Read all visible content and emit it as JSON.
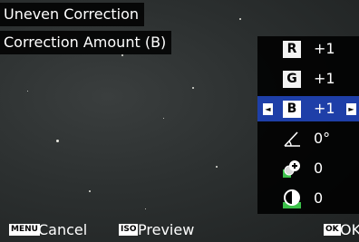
{
  "header": {
    "title": "Uneven Correction",
    "subtitle": "Correction Amount (B)"
  },
  "panel": {
    "items": [
      {
        "label": "R",
        "value": "+1"
      },
      {
        "label": "G",
        "value": "+1"
      },
      {
        "label": "B",
        "value": "+1"
      },
      {
        "icon": "slope-angle-icon",
        "value": "0°"
      },
      {
        "icon": "saturation-plus-icon",
        "value": "0"
      },
      {
        "icon": "contrast-icon",
        "value": "0"
      }
    ],
    "left_arrow": "◄",
    "right_arrow": "►"
  },
  "footer": {
    "cancel_badge": "MENU",
    "cancel_label": "Cancel",
    "preview_badge": "ISO",
    "preview_label": "Preview",
    "ok_badge": "OK",
    "ok_label": "OK"
  },
  "colors": {
    "selected_row": "#1e3fa8",
    "background": "#2c3030"
  }
}
